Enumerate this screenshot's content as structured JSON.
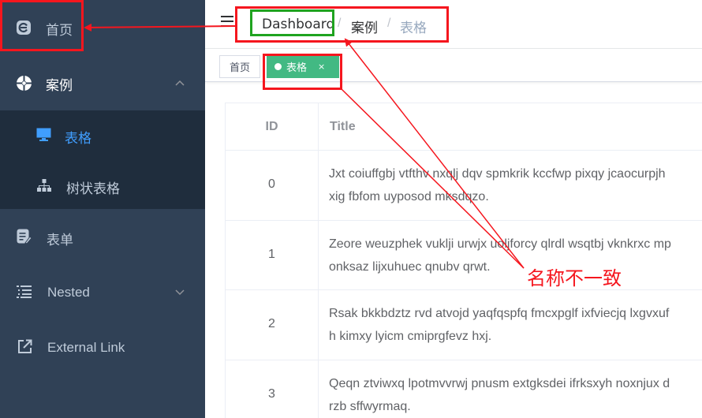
{
  "sidebar": {
    "home": "首页",
    "examples": "案例",
    "table": "表格",
    "tree_table": "树状表格",
    "form": "表单",
    "nested": "Nested",
    "external_link": "External Link"
  },
  "colors": {
    "sidebar_bg": "#304156",
    "submenu_bg": "#1f2d3d",
    "active_text": "#409eff",
    "tag_active": "#42b983",
    "annotation_red": "#f5161e",
    "annotation_green": "#1fa31f"
  },
  "breadcrumb": {
    "items": [
      "Dashboard",
      "案例",
      "表格"
    ],
    "separator": "/"
  },
  "tags": {
    "home": "首页",
    "active": "表格",
    "close": "×"
  },
  "table": {
    "headers": [
      "ID",
      "Title"
    ],
    "rows": [
      {
        "id": "0",
        "line1": "Jxt coiuffgbj vtfthv nxqlj dqv spmkrik kccfwp pixqy jcaocurpjh",
        "line2": "xig fbfom uyposod mksdqzo."
      },
      {
        "id": "1",
        "line1": "Zeore weuzphek vuklji urwjx uoljforcy qlrdl wsqtbj vknkrxc mp",
        "line2": "onksaz lijxuhuec qnubv qrwt."
      },
      {
        "id": "2",
        "line1": "Rsak bkkbdztz rvd atvojd yaqfqspfq fmcxpglf ixfviecjq lxgvxuf",
        "line2": "h kimxy lyicm cmiprgfevz hxj."
      },
      {
        "id": "3",
        "line1": "Qeqn ztviwxq lpotmvvrwj pnusm extgksdei ifrksxyh noxnjux d",
        "line2": "rzb sffwyrmaq."
      }
    ]
  },
  "annotation": {
    "note": "名称不一致"
  }
}
